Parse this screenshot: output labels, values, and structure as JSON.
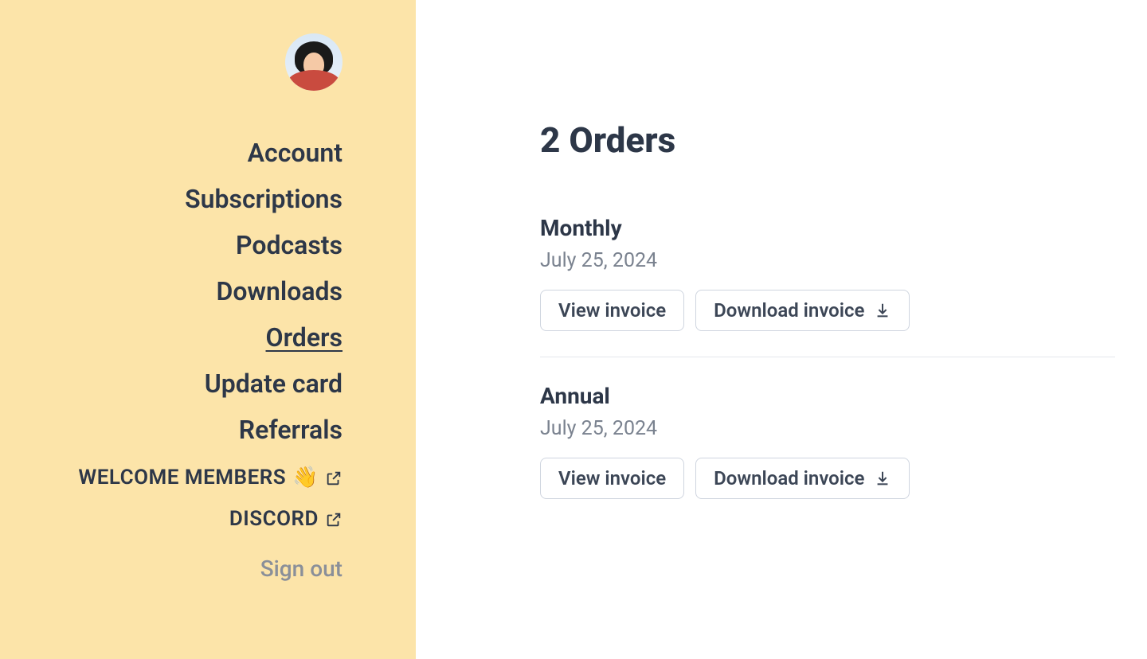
{
  "sidebar": {
    "nav": [
      {
        "label": "Account",
        "active": false
      },
      {
        "label": "Subscriptions",
        "active": false
      },
      {
        "label": "Podcasts",
        "active": false
      },
      {
        "label": "Downloads",
        "active": false
      },
      {
        "label": "Orders",
        "active": true
      },
      {
        "label": "Update card",
        "active": false
      },
      {
        "label": "Referrals",
        "active": false
      }
    ],
    "external": [
      {
        "label": "WELCOME MEMBERS",
        "wave": true
      },
      {
        "label": "DISCORD",
        "wave": false
      }
    ],
    "signout": "Sign out"
  },
  "main": {
    "title": "2 Orders",
    "orders": [
      {
        "name": "Monthly",
        "date": "July 25, 2024",
        "view_label": "View invoice",
        "download_label": "Download invoice"
      },
      {
        "name": "Annual",
        "date": "July 25, 2024",
        "view_label": "View invoice",
        "download_label": "Download invoice"
      }
    ]
  }
}
